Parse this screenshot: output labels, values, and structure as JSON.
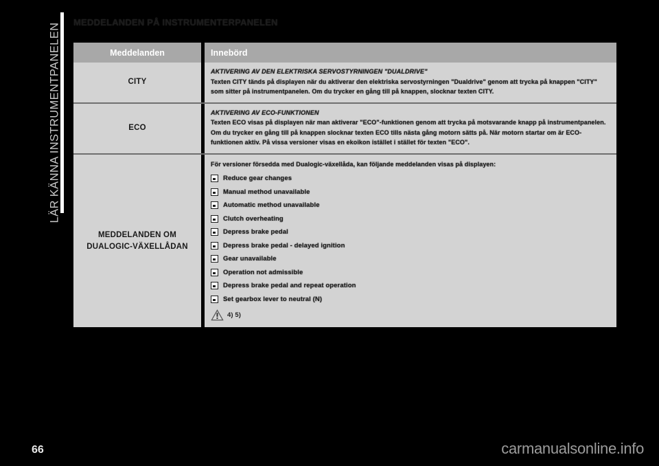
{
  "chapter_tab": {
    "label": "LÄR KÄNNA INSTRUMENTPANELEN"
  },
  "heading": "MEDDELANDEN PÅ INSTRUMENTERPANELEN",
  "table": {
    "headers": {
      "messages": "Meddelanden",
      "meaning": "Innebörd"
    },
    "rows": [
      {
        "label": "CITY",
        "subtitle": "AKTIVERING AV DEN ELEKTRISKA SERVOSTYRNINGEN \"DUALDRIVE\"",
        "body": "Texten CITY tänds på displayen när du aktiverar den elektriska servostyrningen \"Dualdrive\" genom att trycka på knappen \"CITY\" som sitter på instrumentpanelen. Om du trycker en gång till på knappen, slocknar texten CITY."
      },
      {
        "label": "ECO",
        "subtitle": "AKTIVERING AV ECO-FUNKTIONEN",
        "body": "Texten ECO visas på displayen när man aktiverar \"ECO\"-funktionen genom att trycka på motsvarande knapp på instrumentpanelen. Om du trycker en gång till på knappen slocknar texten ECO tills nästa gång motorn sätts på. När motorn startar om är ECO-funktionen aktiv. På vissa versioner visas en ekoikon istället i stället för texten \"ECO\"."
      },
      {
        "label": "MEDDELANDEN OM DUALOGIC-VÄXELLÅDAN",
        "intro": "För versioner försedda med Dualogic-växellåda, kan följande meddelanden visas på displayen:",
        "items": [
          "Reduce gear changes",
          "Manual method unavailable",
          "Automatic method unavailable",
          "Clutch overheating",
          "Depress brake pedal",
          "Depress brake pedal - delayed ignition",
          "Gear unavailable",
          "Operation not admissible",
          "Depress brake pedal and repeat operation",
          "Set gearbox lever to neutral (N)"
        ],
        "warning_text": "4) 5)"
      }
    ]
  },
  "footer": {
    "page_number": "66",
    "watermark": "carmanualsonline.info"
  },
  "colors": {
    "background": "#000000",
    "table_cell": "#d3d3d3",
    "table_header": "#a8a8a8",
    "divider": "#6f6f6f",
    "text": "#1f1f1f"
  }
}
